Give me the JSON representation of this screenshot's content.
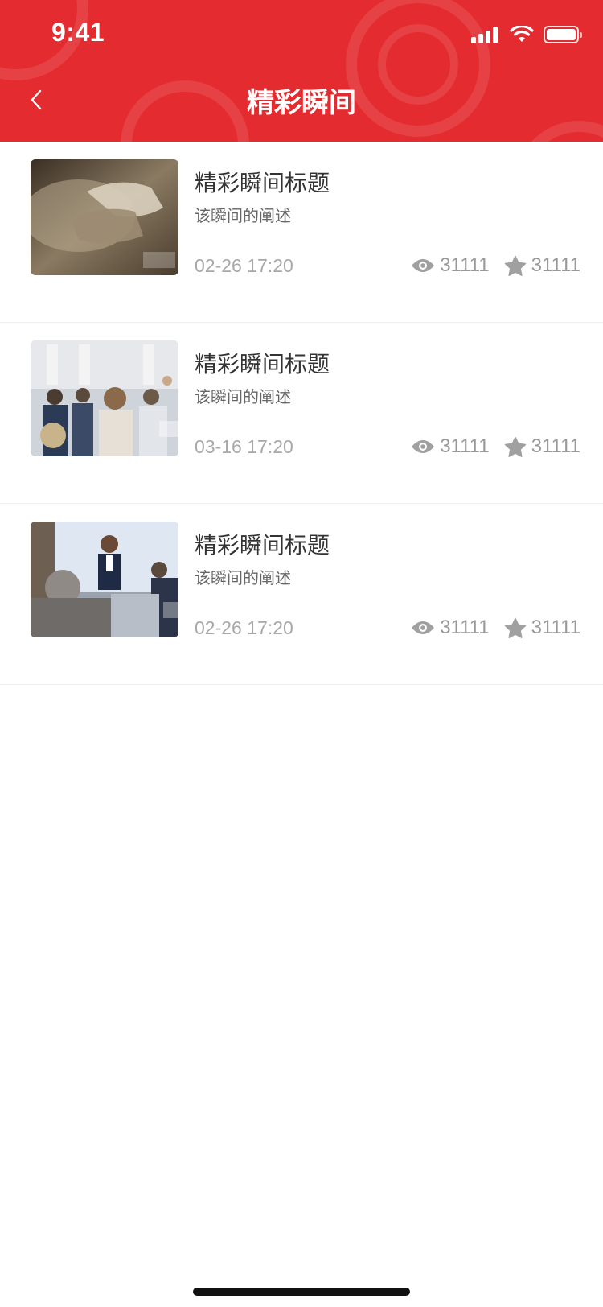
{
  "status_bar": {
    "time": "9:41"
  },
  "nav": {
    "title": "精彩瞬间",
    "back_icon": "chevron-left-icon"
  },
  "colors": {
    "header_bg": "#e42c30",
    "meta_gray": "#a8a8a8"
  },
  "items": [
    {
      "title": "精彩瞬间标题",
      "desc": "该瞬间的阐述",
      "date": "02-26 17:20",
      "views": "31111",
      "likes": "31111",
      "thumb_icon": "handshake-photo"
    },
    {
      "title": "精彩瞬间标题",
      "desc": "该瞬间的阐述",
      "date": "03-16  17:20",
      "views": "31111",
      "likes": "31111",
      "thumb_icon": "audience-applause-photo"
    },
    {
      "title": "精彩瞬间标题",
      "desc": "该瞬间的阐述",
      "date": "02-26 17:20",
      "views": "31111",
      "likes": "31111",
      "thumb_icon": "presenter-photo"
    }
  ]
}
